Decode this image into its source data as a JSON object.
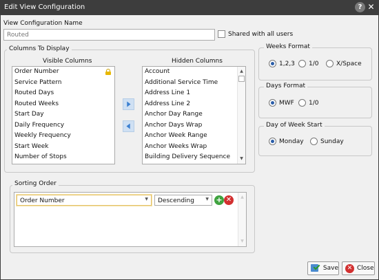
{
  "window": {
    "title": "Edit View Configuration",
    "help_label": "?",
    "close_label": "✕"
  },
  "name": {
    "label": "View Configuration Name",
    "placeholder": "Routed",
    "value": "",
    "shared_label": "Shared with all users"
  },
  "columns": {
    "title": "Columns To Display",
    "visible_header": "Visible Columns",
    "hidden_header": "Hidden Columns",
    "visible": [
      "Order Number",
      "Service Pattern",
      "Routed Days",
      "Routed Weeks",
      "Start Day",
      "Daily Frequency",
      "Weekly Frequency",
      "Start Week",
      "Number of Stops"
    ],
    "hidden": [
      "Account",
      "Additional Service Time",
      "Address Line 1",
      "Address Line 2",
      "Anchor Day Range",
      "Anchor Days Wrap",
      "Anchor Week Range",
      "Anchor Weeks Wrap",
      "Building Delivery Sequence"
    ]
  },
  "weeks_format": {
    "title": "Weeks Format",
    "options": [
      "1,2,3",
      "1/0",
      "X/Space"
    ],
    "selected": 0
  },
  "days_format": {
    "title": "Days Format",
    "options": [
      "MWF",
      "1/0"
    ],
    "selected": 0
  },
  "day_of_week_start": {
    "title": "Day of Week Start",
    "options": [
      "Monday",
      "Sunday"
    ],
    "selected": 0
  },
  "sorting": {
    "title": "Sorting Order",
    "column_value": "Order Number",
    "direction_value": "Descending",
    "add_label": "+",
    "remove_label": "✕"
  },
  "actions": {
    "save_label": "Save",
    "close_label": "Close"
  },
  "colors": {
    "titlebar": "#3d3d3d",
    "accent_blue": "#2a5da8",
    "add_green": "#3fa33f",
    "remove_red": "#d23030"
  }
}
